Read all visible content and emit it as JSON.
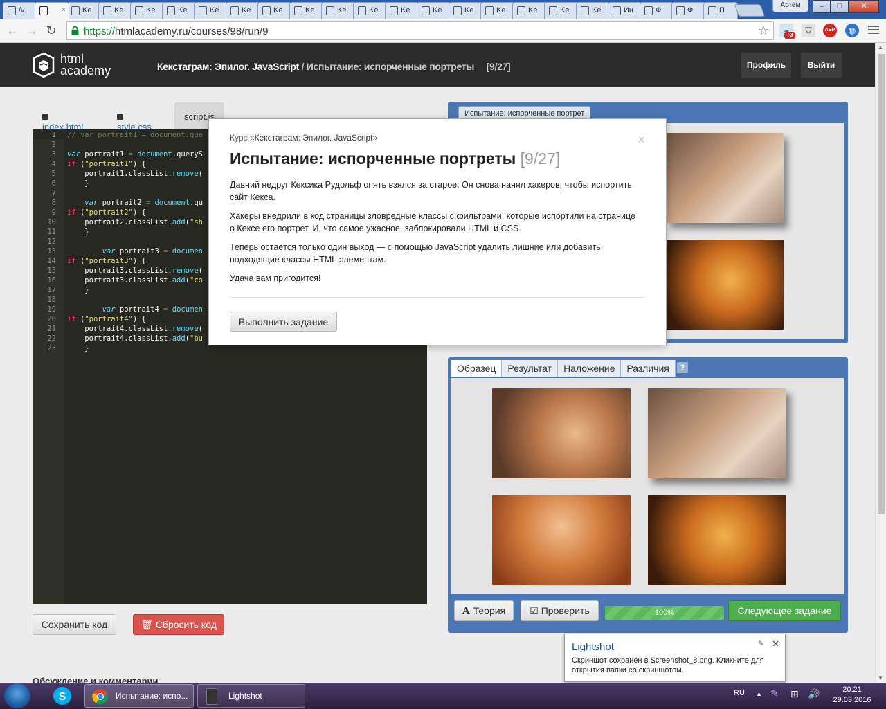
{
  "browser": {
    "tabs": [
      {
        "label": "/v",
        "active": false
      },
      {
        "label": "",
        "active": true
      },
      {
        "label": "Ke"
      },
      {
        "label": "Ke"
      },
      {
        "label": "Ke"
      },
      {
        "label": "Ke"
      },
      {
        "label": "Ke"
      },
      {
        "label": "Ke"
      },
      {
        "label": "Ke"
      },
      {
        "label": "Ke"
      },
      {
        "label": "Ke"
      },
      {
        "label": "Ke"
      },
      {
        "label": "Ke"
      },
      {
        "label": "Ke"
      },
      {
        "label": "Ke"
      },
      {
        "label": "Ke"
      },
      {
        "label": "Ke"
      },
      {
        "label": "Ke"
      },
      {
        "label": "Ke"
      },
      {
        "label": "Ин"
      },
      {
        "label": "Ф"
      },
      {
        "label": "Ф"
      },
      {
        "label": "П"
      }
    ],
    "user_badge": "Артем",
    "url_scheme": "https://",
    "url_rest": "htmlacademy.ru/courses/98/run/9",
    "ext_badge": "+3",
    "abp_label": "ABP"
  },
  "header": {
    "logo_line1": "html",
    "logo_line2": "academy",
    "course_link": "Кекстаграм: Эпилог. JavaScript",
    "separator": "/",
    "task_title": "Испытание: испорченные портреты",
    "counter": "[9/27]",
    "profile_btn": "Профиль",
    "logout_btn": "Выйти"
  },
  "editor": {
    "tabs": [
      "index.html",
      "style.css",
      "script.js"
    ],
    "lines": [
      [
        [
          "c",
          "// var portrait1 = document.que"
        ]
      ],
      [],
      [
        [
          "k",
          "var"
        ],
        [
          "t",
          " portrait1 "
        ],
        [
          "kw",
          "="
        ],
        [
          "t",
          " "
        ],
        [
          "f",
          "document"
        ],
        [
          "t",
          ".queryS"
        ]
      ],
      [
        [
          "kw",
          "if"
        ],
        [
          "t",
          " ("
        ],
        [
          "s",
          "\"portrait1\""
        ],
        [
          "t",
          ") {"
        ]
      ],
      [
        [
          "t",
          "    portrait1.classList."
        ],
        [
          "f",
          "remove"
        ],
        [
          "t",
          "("
        ]
      ],
      [
        [
          "t",
          "    }"
        ]
      ],
      [],
      [
        [
          "t",
          "    "
        ],
        [
          "k",
          "var"
        ],
        [
          "t",
          " portrait2 "
        ],
        [
          "kw",
          "="
        ],
        [
          "t",
          " "
        ],
        [
          "f",
          "document"
        ],
        [
          "t",
          ".qu"
        ]
      ],
      [
        [
          "kw",
          "if"
        ],
        [
          "t",
          " ("
        ],
        [
          "s",
          "\"portrait2\""
        ],
        [
          "t",
          ") {"
        ]
      ],
      [
        [
          "t",
          "    portrait2.classList."
        ],
        [
          "f",
          "add"
        ],
        [
          "t",
          "("
        ],
        [
          "s",
          "\"sh"
        ]
      ],
      [
        [
          "t",
          "    }"
        ]
      ],
      [],
      [
        [
          "t",
          "        "
        ],
        [
          "k",
          "var"
        ],
        [
          "t",
          " portrait3 "
        ],
        [
          "kw",
          "="
        ],
        [
          "t",
          " "
        ],
        [
          "f",
          "documen"
        ]
      ],
      [
        [
          "kw",
          "if"
        ],
        [
          "t",
          " ("
        ],
        [
          "s",
          "\"portrait3\""
        ],
        [
          "t",
          ") {"
        ]
      ],
      [
        [
          "t",
          "    portrait3.classList."
        ],
        [
          "f",
          "remove"
        ],
        [
          "t",
          "("
        ]
      ],
      [
        [
          "t",
          "    portrait3.classList."
        ],
        [
          "f",
          "add"
        ],
        [
          "t",
          "("
        ],
        [
          "s",
          "\"co"
        ]
      ],
      [
        [
          "t",
          "    }"
        ]
      ],
      [],
      [
        [
          "t",
          "        "
        ],
        [
          "k",
          "var"
        ],
        [
          "t",
          " portrait4 "
        ],
        [
          "kw",
          "="
        ],
        [
          "t",
          " "
        ],
        [
          "f",
          "documen"
        ]
      ],
      [
        [
          "kw",
          "if"
        ],
        [
          "t",
          " ("
        ],
        [
          "s",
          "\"portrait4\""
        ],
        [
          "t",
          ") {"
        ]
      ],
      [
        [
          "t",
          "    portrait4.classList."
        ],
        [
          "f",
          "remove"
        ],
        [
          "t",
          "("
        ]
      ],
      [
        [
          "t",
          "    portrait4.classList."
        ],
        [
          "f",
          "add"
        ],
        [
          "t",
          "("
        ],
        [
          "s",
          "\"bu"
        ]
      ],
      [
        [
          "t",
          "    }"
        ]
      ]
    ],
    "save_btn": "Сохранить код",
    "reset_btn": "Сбросить код"
  },
  "discussion_label": "Обсуждение и комментарии",
  "result_panel": {
    "tab_label": "Испытание: испорченные портрет"
  },
  "view_panel": {
    "tabs": [
      "Образец",
      "Результат",
      "Наложение",
      "Различия"
    ],
    "help": "?",
    "theory_btn": "Теория",
    "check_btn": "Проверить",
    "progress_text": "100%",
    "progress": 1.0,
    "next_btn": "Следующее задание"
  },
  "modal": {
    "course_prefix": "Курс «",
    "course_name": "Кекстаграм: Эпилог. JavaScript",
    "course_suffix": "»",
    "title": "Испытание: испорченные портреты",
    "title_num": "[9/27]",
    "paragraphs": [
      "Давний недруг Кексика Рудольф опять взялся за старое. Он снова нанял хакеров, чтобы испортить сайт Кекса.",
      "Хакеры внедрили в код страницы зловредные классы с фильтрами, которые испортили на странице о Кексе его портрет. И, что самое ужасное, заблокировали HTML и CSS.",
      "Теперь остаётся только один выход — с помощью JavaScript удалить лишние или добавить подходящие классы HTML-элементам.",
      "Удача вам пригодится!"
    ],
    "action_btn": "Выполнить задание",
    "close": "×"
  },
  "lightshot": {
    "title": "Lightshot",
    "message": "Скриншот сохранён в Screenshot_8.png. Кликните для открытия папки со скриншотом."
  },
  "taskbar": {
    "chrome_item": "Испытание: испо...",
    "lightshot_item": "Lightshot",
    "lang": "RU",
    "time": "20:21",
    "date": "29.03.2016"
  },
  "colors": {
    "accent_blue": "#4c77b5",
    "header_dark": "#2b2b2b",
    "editor_bg": "#272822",
    "green": "#4cae4c",
    "red": "#d9534f"
  }
}
